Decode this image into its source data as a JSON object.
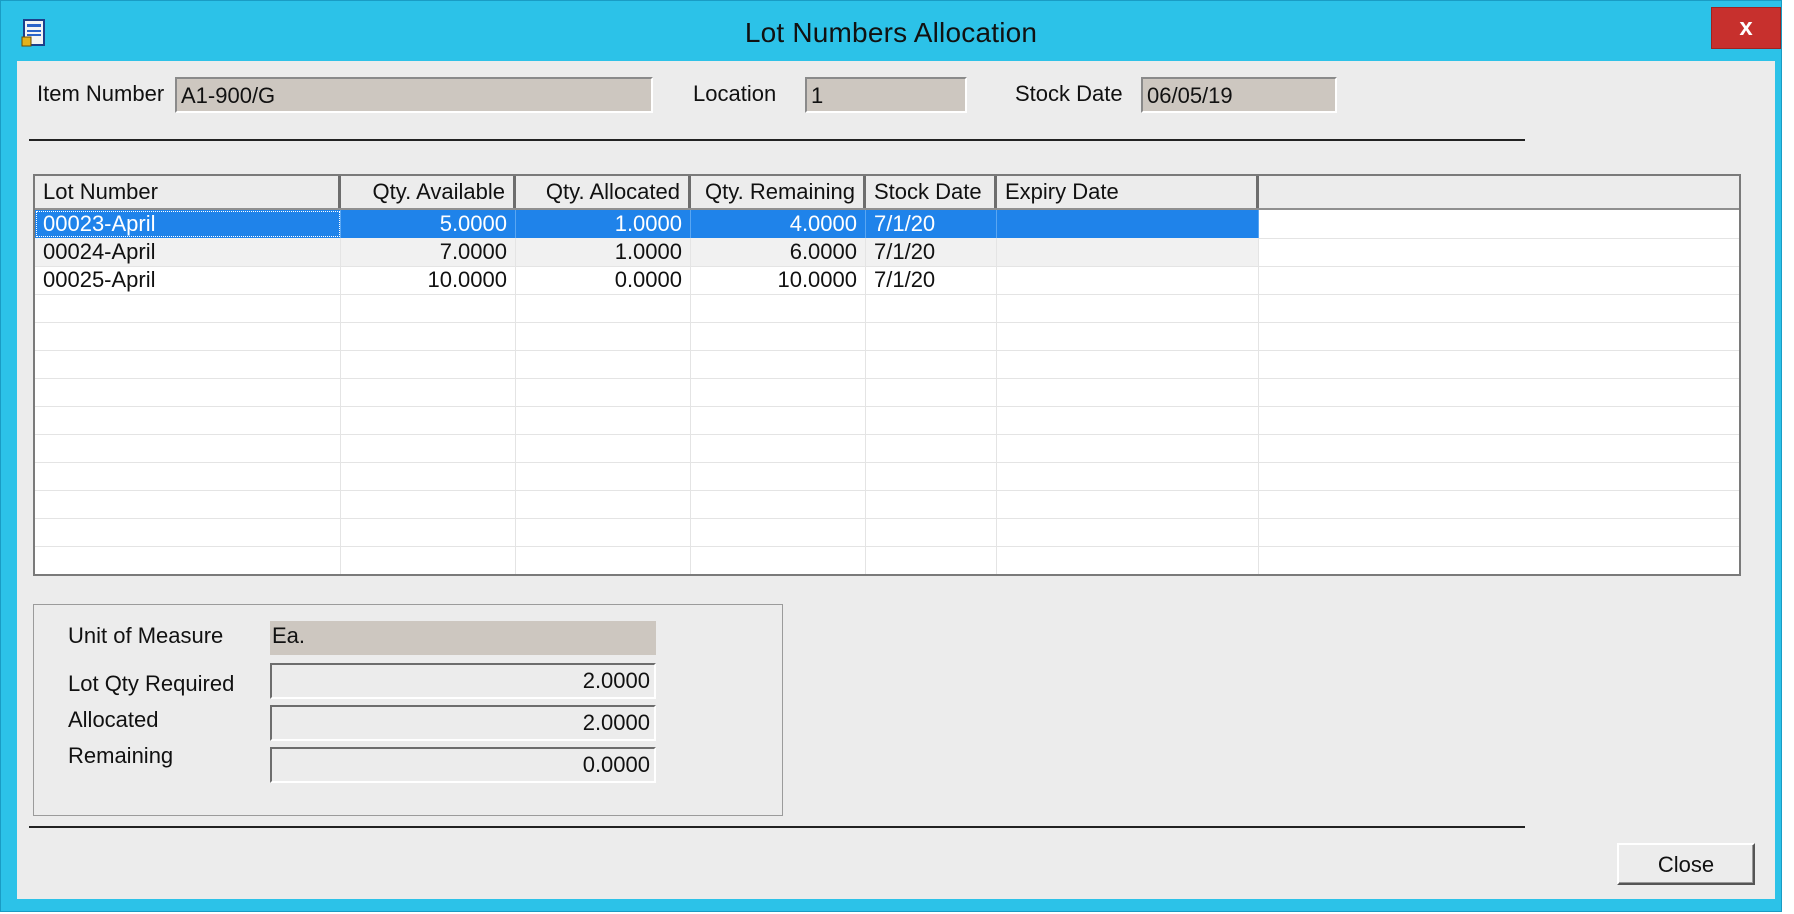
{
  "window": {
    "title": "Lot Numbers Allocation",
    "close_glyph": "x",
    "icon": "document-app-icon"
  },
  "header": {
    "item_number_label": "Item Number",
    "item_number_value": "A1-900/G",
    "location_label": "Location",
    "location_value": "1",
    "stock_date_label": "Stock Date",
    "stock_date_value": "06/05/19"
  },
  "grid": {
    "columns": [
      "Lot Number",
      "Qty. Available",
      "Qty. Allocated",
      "Qty. Remaining",
      "Stock Date",
      "Expiry Date"
    ],
    "rows": [
      {
        "lot": "00023-April",
        "available": "5.0000",
        "allocated": "1.0000",
        "remaining": "4.0000",
        "stock_date": "7/1/20",
        "expiry": ""
      },
      {
        "lot": "00024-April",
        "available": "7.0000",
        "allocated": "1.0000",
        "remaining": "6.0000",
        "stock_date": "7/1/20",
        "expiry": ""
      },
      {
        "lot": "00025-April",
        "available": "10.0000",
        "allocated": "0.0000",
        "remaining": "10.0000",
        "stock_date": "7/1/20",
        "expiry": ""
      }
    ],
    "selected_row": 0
  },
  "summary": {
    "uom_label": "Unit of Measure",
    "uom_value": "Ea.",
    "lot_qty_required_label": "Lot Qty Required",
    "lot_qty_required_value": "2.0000",
    "allocated_label": "Allocated",
    "allocated_value": "2.0000",
    "remaining_label": "Remaining",
    "remaining_value": "0.0000"
  },
  "buttons": {
    "close_label": "Close"
  },
  "colors": {
    "titlebar": "#2cc2e8",
    "selection": "#1f83ea",
    "close_button": "#c7302d"
  }
}
